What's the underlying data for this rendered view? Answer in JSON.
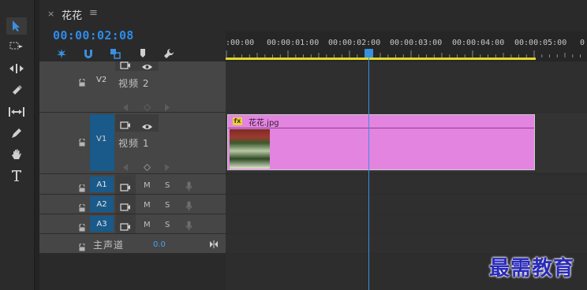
{
  "panel": {
    "close_glyph": "×",
    "title": "花花",
    "menu_glyph": "≡"
  },
  "timecode": "00:00:02:08",
  "ruler": {
    "labels": [
      ":00:00",
      "00:00:01:00",
      "00:00:02:00",
      "00:00:03:00",
      "00:00:04:00",
      "00:00:05:00",
      "0"
    ]
  },
  "tools": [
    "selection-tool-icon",
    "track-select-icon",
    "ripple-edit-icon",
    "razor-icon",
    "slip-icon",
    "pen-icon",
    "hand-icon",
    "type-icon"
  ],
  "tracks": {
    "v2": {
      "label": "V2",
      "name": "视频 2"
    },
    "v1": {
      "label": "V1",
      "target": "V1",
      "name": "视频 1"
    },
    "audio": [
      {
        "target": "A1",
        "m": "M",
        "s": "S"
      },
      {
        "target": "A2",
        "m": "M",
        "s": "S"
      },
      {
        "target": "A3",
        "m": "M",
        "s": "S"
      }
    ],
    "master": {
      "name": "主声道",
      "value": "0.0"
    }
  },
  "clip": {
    "fx": "fx",
    "name": "花花.jpg",
    "color": "#e384e0"
  },
  "watermark": "最需教育",
  "colors": {
    "accent": "#2d8ceb",
    "workarea": "#e1d92b",
    "target": "#195a8a"
  }
}
